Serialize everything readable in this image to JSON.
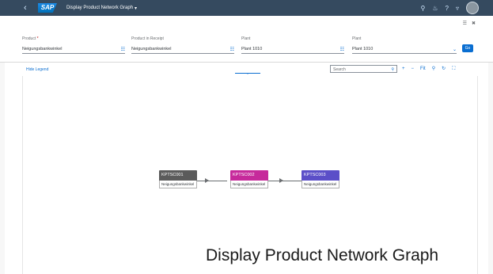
{
  "shell": {
    "back_icon": "back-arrow",
    "logo": "SAP",
    "app_title": "Display Product Network Graph",
    "actions": [
      "search-icon",
      "bell-icon",
      "help-icon",
      "user-icon"
    ]
  },
  "filterbar": {
    "icons": [
      "adapt-filters-icon",
      "expand-icon"
    ],
    "fields": [
      {
        "label": "Product",
        "required": true,
        "value": "Neigungsbankwinkel"
      },
      {
        "label": "Product in Receipt",
        "required": false,
        "value": "Neigungsbankwinkel"
      },
      {
        "label": "Plant",
        "required": false,
        "value": "Plant 1010"
      },
      {
        "label": "Plant",
        "required": false,
        "value": "Plant 1010"
      }
    ],
    "go_label": "Go"
  },
  "toolbar": {
    "legend_label": "Hide Legend",
    "search_placeholder": "Search",
    "buttons": [
      "zoom-in-icon",
      "zoom-out-icon",
      "fit-label",
      "search-icon",
      "refresh-icon",
      "fullscreen-icon"
    ],
    "fit_label": "Fit"
  },
  "graph": {
    "nodes": [
      {
        "id": "KPTSC001",
        "subtitle": "Neigungsbankwinkel",
        "color": "#5b5b5b"
      },
      {
        "id": "KPTSC002",
        "subtitle": "Neigungsbankwinkel",
        "color": "#c62a9b"
      },
      {
        "id": "KPTSC003",
        "subtitle": "Neigungsbankwinkel",
        "color": "#5b4fc8"
      }
    ]
  },
  "caption": "Display Product Network Graph"
}
